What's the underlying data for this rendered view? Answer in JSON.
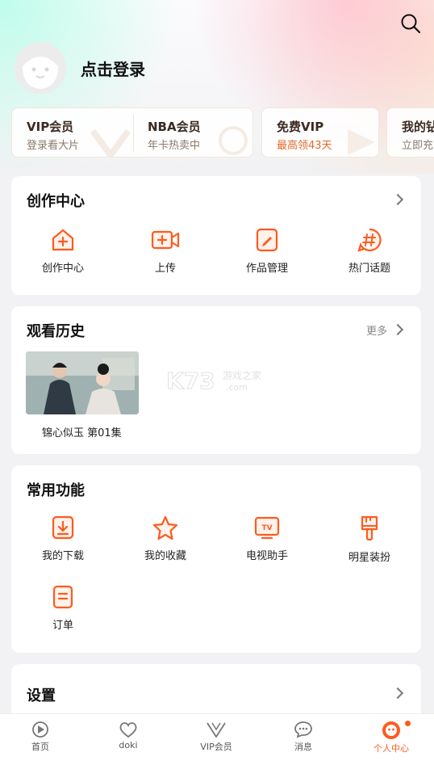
{
  "header": {
    "login_text": "点击登录"
  },
  "vip_cards": [
    {
      "title": "VIP会员",
      "subtitle": "登录看大片"
    },
    {
      "title": "NBA会员",
      "subtitle": "年卡热卖中"
    },
    {
      "title": "免费VIP",
      "subtitle": "最高领43天"
    },
    {
      "title": "我的钻",
      "subtitle": "立即充"
    }
  ],
  "create_center": {
    "title": "创作中心",
    "items": [
      {
        "label": "创作中心",
        "icon": "home-plus-icon"
      },
      {
        "label": "上传",
        "icon": "video-upload-icon"
      },
      {
        "label": "作品管理",
        "icon": "edit-icon"
      },
      {
        "label": "热门话题",
        "icon": "hashtag-icon"
      }
    ]
  },
  "history": {
    "title": "观看历史",
    "more": "更多",
    "items": [
      {
        "label": "锦心似玉 第01集"
      }
    ]
  },
  "watermark": {
    "brand": "K73",
    "text": "游戏之家",
    "domain": ".com"
  },
  "functions": {
    "title": "常用功能",
    "items": [
      {
        "label": "我的下载",
        "icon": "download-icon"
      },
      {
        "label": "我的收藏",
        "icon": "star-icon"
      },
      {
        "label": "电视助手",
        "icon": "tv-icon"
      },
      {
        "label": "明星装扮",
        "icon": "brush-icon"
      },
      {
        "label": "订单",
        "icon": "order-icon"
      }
    ]
  },
  "settings": {
    "title": "设置"
  },
  "tabbar": [
    {
      "label": "首页",
      "icon": "home-play-icon"
    },
    {
      "label": "doki",
      "icon": "doki-heart-icon"
    },
    {
      "label": "VIP会员",
      "icon": "vip-v-icon"
    },
    {
      "label": "消息",
      "icon": "message-icon"
    },
    {
      "label": "个人中心",
      "icon": "profile-icon",
      "active": true
    }
  ],
  "colors": {
    "accent": "#ff5a1f",
    "accent_light": "#ffb08a",
    "vip_text": "#3a2a20"
  }
}
